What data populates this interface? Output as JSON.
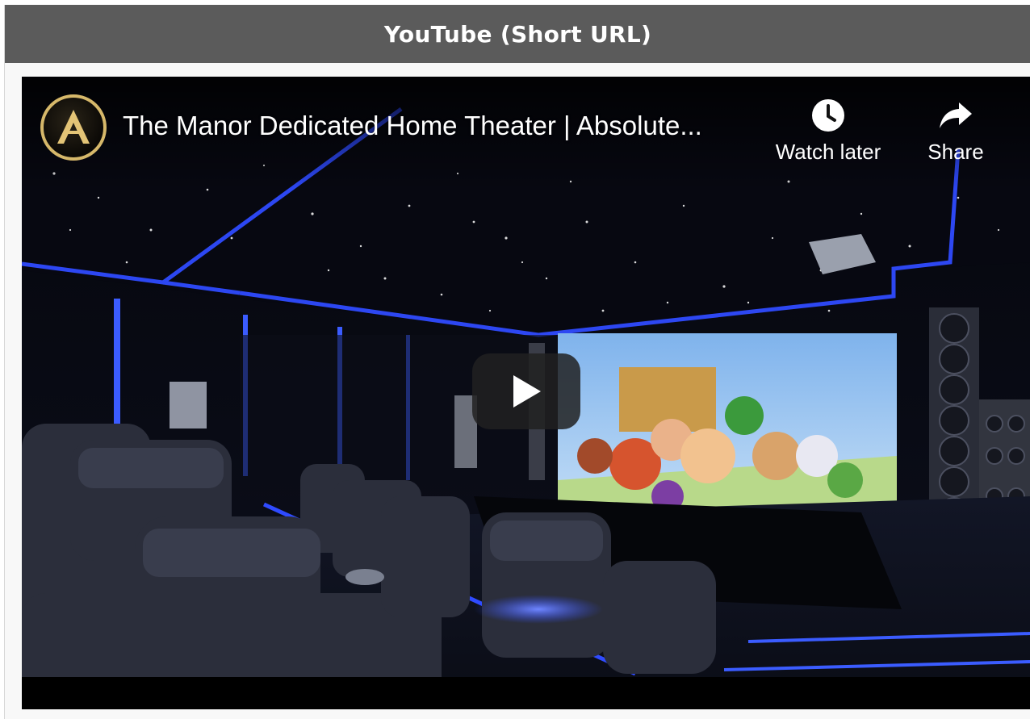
{
  "panel": {
    "title": "YouTube (Short URL)"
  },
  "video": {
    "title": "The Manor Dedicated Home Theater | Absolute...",
    "actions": {
      "watch_later": "Watch later",
      "share": "Share"
    },
    "icons": {
      "channel_logo": "channel-logo-icon",
      "watch_later": "clock-icon",
      "share": "share-arrow-icon",
      "play": "play-icon"
    },
    "colors": {
      "header_bg": "#5b5b5b",
      "led_blue": "#2f4bff",
      "play_bg": "#212121"
    }
  }
}
